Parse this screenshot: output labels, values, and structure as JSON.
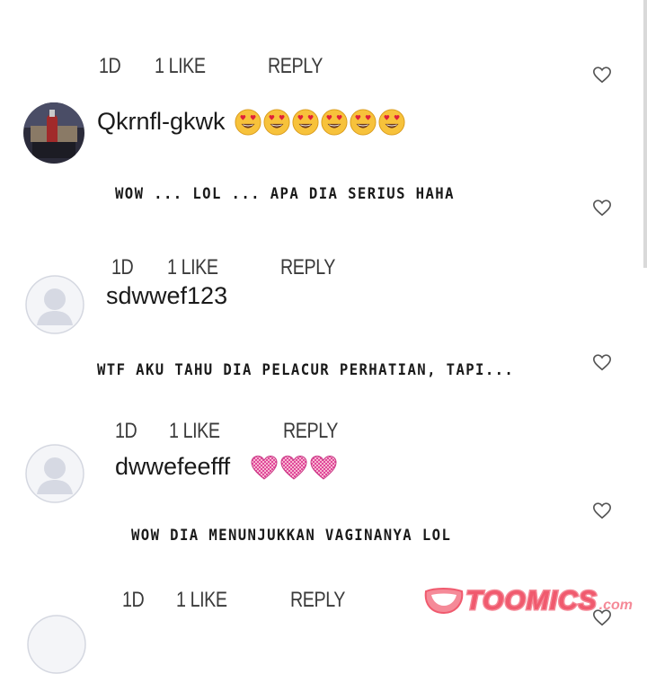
{
  "comments": [
    {
      "meta": {
        "age": "1D",
        "likes": "1 LIKE",
        "reply": "REPLY"
      }
    },
    {
      "username": "Qkrnfl-gkwk",
      "emoji_count": 6,
      "text": "WOW ... LOL ... APA DIA SERIUS HAHA",
      "meta": {
        "age": "1D",
        "likes": "1 LIKE",
        "reply": "REPLY"
      }
    },
    {
      "username": "sdwwef123",
      "text": "WTF AKU TAHU DIA PELACUR PERHATIAN, TAPI...",
      "meta": {
        "age": "1D",
        "likes": "1 LIKE",
        "reply": "REPLY"
      }
    },
    {
      "username": "dwwefeefff",
      "heart_emoji_count": 3,
      "text": "WOW DIA MENUNJUKKAN VAGINANYA LOL",
      "meta": {
        "age": "1D",
        "likes": "1 LIKE",
        "reply": "REPLY"
      }
    }
  ],
  "icons": {
    "like": "heart-outline-icon",
    "avatar_default": "default-avatar-icon",
    "emoji_heart_eyes": "heart-eyes-emoji",
    "emoji_pink_heart": "pink-checkered-heart-emoji"
  },
  "watermark": {
    "text": "TOOMICS",
    "suffix": ".com"
  },
  "colors": {
    "watermark": "#f05a6e",
    "avatar_default": "#d6d9e3",
    "heart_outline": "#555555"
  }
}
